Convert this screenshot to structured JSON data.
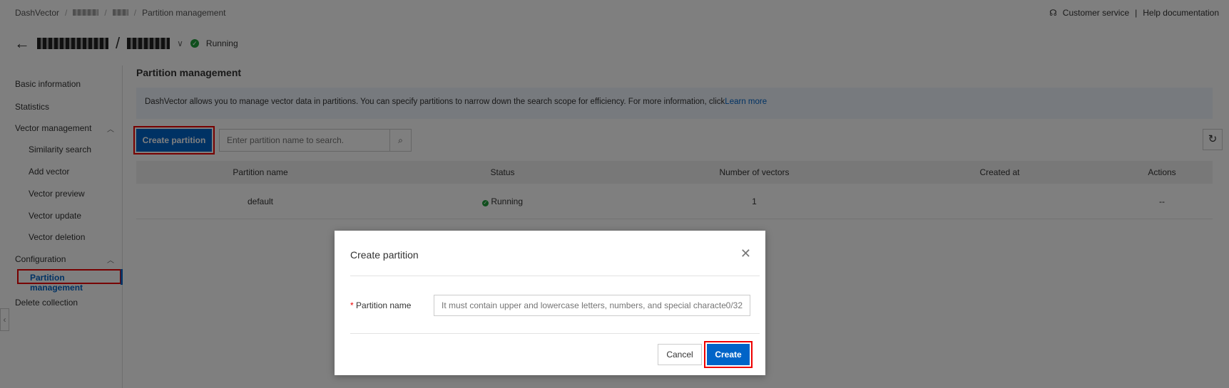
{
  "breadcrumb": [
    "DashVector",
    "Partition management"
  ],
  "top_links": {
    "customer_service": "Customer service",
    "divider": "|",
    "help": "Help documentation"
  },
  "header": {
    "status": "Running"
  },
  "sidebar": {
    "items": [
      {
        "label": "Basic information"
      },
      {
        "label": "Statistics"
      },
      {
        "label": "Vector management"
      },
      {
        "label": "Similarity search"
      },
      {
        "label": "Add vector"
      },
      {
        "label": "Vector preview"
      },
      {
        "label": "Vector update"
      },
      {
        "label": "Vector deletion"
      },
      {
        "label": "Configuration"
      },
      {
        "label": "Partition management"
      },
      {
        "label": "Delete collection"
      }
    ]
  },
  "main": {
    "title": "Partition management",
    "info": "DashVector allows you to manage vector data in partitions. You can specify partitions to narrow down the search scope for efficiency. For more information, click",
    "learn_more": "Learn more",
    "create_button": "Create partition",
    "search_placeholder": "Enter partition name to search.",
    "columns": [
      "Partition name",
      "Status",
      "Number of vectors",
      "Created at",
      "Actions"
    ],
    "rows": [
      {
        "name": "default",
        "status": "Running",
        "vectors": "1",
        "created": "",
        "actions": "--"
      }
    ]
  },
  "modal": {
    "title": "Create partition",
    "field_label": "Partition name",
    "placeholder": "It must contain upper and lowercase letters, numbers, and special characters (_,-).",
    "counter": "0/32",
    "cancel": "Cancel",
    "create": "Create"
  },
  "colors": {
    "primary": "#0064c8",
    "highlight": "#e00000",
    "success": "#1e9e3a"
  }
}
